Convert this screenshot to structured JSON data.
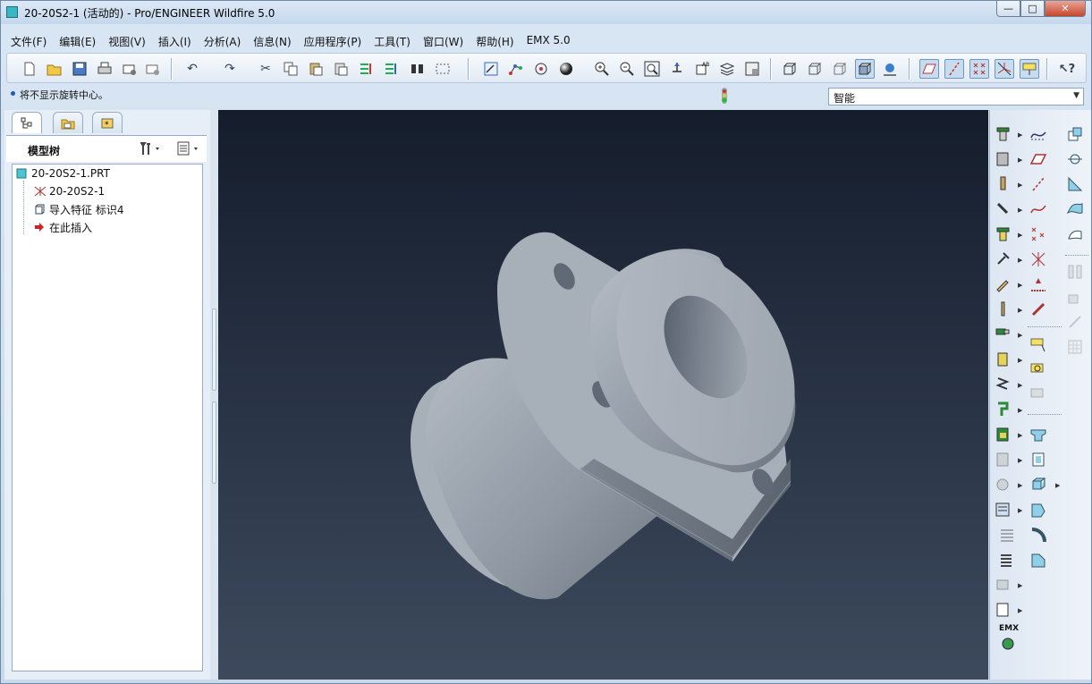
{
  "window": {
    "title": "20-20S2-1 (活动的) - Pro/ENGINEER Wildfire 5.0",
    "minimize_label": "—",
    "maximize_label": "□",
    "close_label": "✕"
  },
  "menu": {
    "items": [
      "文件(F)",
      "编辑(E)",
      "视图(V)",
      "插入(I)",
      "分析(A)",
      "信息(N)",
      "应用程序(P)",
      "工具(T)",
      "窗口(W)",
      "帮助(H)",
      "EMX 5.0"
    ]
  },
  "toolbar": {
    "icons": [
      "new-icon",
      "open-icon",
      "save-icon",
      "print-icon",
      "email-icon",
      "email-link-icon",
      "undo-icon",
      "redo-icon",
      "cut-icon",
      "copy-icon",
      "paste-icon",
      "paste-special-icon",
      "regenerate-icon",
      "regen-manager-icon",
      "find-icon",
      "select-box-icon",
      "sketch-icon",
      "orient-icon",
      "spin-center-icon",
      "appearance-icon",
      "zoom-in-icon",
      "zoom-out-icon",
      "refit-icon",
      "reorient-icon",
      "named-views-icon",
      "layers-icon",
      "view-manager-icon",
      "wireframe-icon",
      "hidden-line-icon",
      "no-hidden-icon",
      "shaded-icon",
      "enhanced-realism-icon",
      "datum-planes-icon",
      "datum-axes-icon",
      "datum-points-icon",
      "coordinate-systems-icon",
      "annotations-icon",
      "context-help-icon"
    ]
  },
  "status": {
    "message": "将不显示旋转中心。",
    "filter_value": "智能"
  },
  "navigator": {
    "tree_title": "模型树",
    "nodes": [
      {
        "label": "20-20S2-1.PRT"
      },
      {
        "label": "20-20S2-1"
      },
      {
        "label": "导入特征 标识4"
      },
      {
        "label": "在此插入"
      }
    ]
  },
  "right_toolbar": {
    "emx_label": "EMX"
  },
  "colors": {
    "viewport_top": "#151d2c",
    "viewport_bottom": "#3d4a5d",
    "model_fill": "#a3abb5"
  }
}
